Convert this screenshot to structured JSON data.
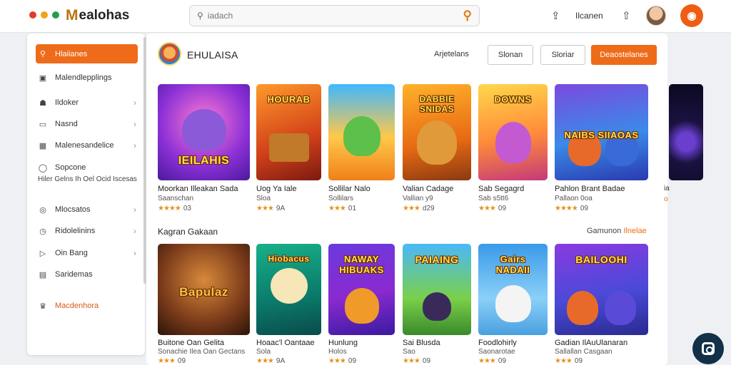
{
  "app": {
    "brand_m": "M",
    "brand_rest": "ealohas",
    "dot_colors": [
      "#e23b2e",
      "#f2a31a",
      "#22a04b"
    ]
  },
  "search": {
    "placeholder": "iadach"
  },
  "topbar": {
    "notifications_label": "Ilcanen",
    "accent": "#ee5d14"
  },
  "sidebar": {
    "items": [
      {
        "label": "Hlaiianes",
        "icon": "search-icon",
        "chevron": false
      },
      {
        "label": "Malendlepplings",
        "icon": "picture-icon",
        "chevron": false
      },
      {
        "label": "Ildoker",
        "icon": "home-icon",
        "chevron": true
      },
      {
        "label": "Nasnd",
        "icon": "folder-icon",
        "chevron": true
      },
      {
        "label": "Malenesandelice",
        "icon": "tag-icon",
        "chevron": true
      },
      {
        "label": "Sopcone",
        "icon": "gamepad-icon",
        "chevron": false
      },
      {
        "label": "Mlocsatos",
        "icon": "target-icon",
        "chevron": true
      },
      {
        "label": "Ridolelinins",
        "icon": "clock-icon",
        "chevron": true
      },
      {
        "label": "Oin Bang",
        "icon": "play-icon",
        "chevron": true
      },
      {
        "label": "Saridemas",
        "icon": "list-icon",
        "chevron": false
      },
      {
        "label": "Macdenhora",
        "icon": "trophy-icon",
        "chevron": false
      }
    ],
    "sub_text": "Hiler Gelns Ih Oel Ocid Iscesas"
  },
  "header": {
    "profile_name": "EHULAISA",
    "link": "Arjetelans",
    "buttons": [
      "Slonan",
      "Sloriar",
      "Deaostelanes"
    ]
  },
  "row1": [
    {
      "art": "IEILAHIS",
      "title": "Moorkan Illeakan Sada",
      "meta": "Saanschan",
      "rating": "03"
    },
    {
      "art": "HOURAB",
      "title": "Uog Ya Iale",
      "meta": "Sloa",
      "rating": "9A"
    },
    {
      "art": "",
      "title": "Sollilar Nalo",
      "meta": "Sollilars",
      "rating": "01"
    },
    {
      "art": "DABBIE SNIDAS",
      "title": "Valian Cadage",
      "meta": "Vallian y9",
      "rating": "d29"
    },
    {
      "art": "DOWNS",
      "title": "Sab Segagrd",
      "meta": "Sab s5tt6",
      "rating": "09"
    },
    {
      "art": "NAIBS SIIAOAS",
      "title": "Pahlon Brant Badae",
      "meta": "Pallaon 0oa",
      "rating": "09"
    }
  ],
  "section": {
    "title": "Kagran Gakaan",
    "link_pre": "Gamunon",
    "link_accent": "Ilnelae"
  },
  "row2": [
    {
      "art": "Bapulaz",
      "title": "Buitone Oan Gelita",
      "meta": "Sonachie Ilea Oan Gectans",
      "rating": "09"
    },
    {
      "art": "Hiobacus",
      "title": "Hoaac'l Oantaae",
      "meta": "Sola",
      "rating": "9A"
    },
    {
      "art": "NAWAY HIBUAKS",
      "title": "Hunlung",
      "meta": "Holos",
      "rating": "09"
    },
    {
      "art": "PAIAING",
      "title": "Sai Blusda",
      "meta": "Sao",
      "rating": "09"
    },
    {
      "art": "Gairs NADAII",
      "title": "Foodlohirly",
      "meta": "Saonarotae",
      "rating": "09"
    },
    {
      "art": "BAILOOHI",
      "title": "Gadian IlAuUlanaran",
      "meta": "Sallallan Casgaan",
      "rating": "09"
    }
  ],
  "peek": {
    "title": "ia",
    "meta": "o"
  }
}
